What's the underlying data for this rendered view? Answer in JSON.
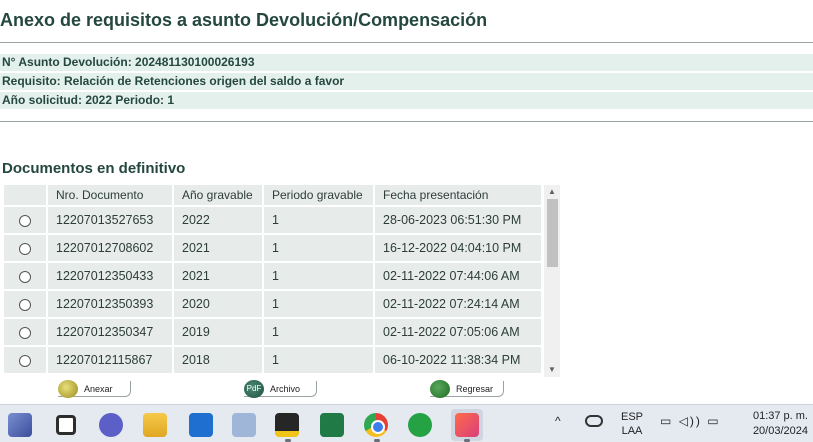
{
  "page": {
    "title": "Anexo de requisitos a asunto Devolución/Compensación"
  },
  "info": {
    "asunto": "N° Asunto Devolución: 202481130100026193",
    "requisito": "Requisito: Relación de Retenciones origen del saldo a favor",
    "anio_solicitud": "Año solicitud: 2022 Periodo: 1"
  },
  "documents": {
    "section_title": "Documentos en definitivo",
    "columns": [
      "Nro. Documento",
      "Año gravable",
      "Periodo gravable",
      "Fecha presentación"
    ],
    "rows": [
      {
        "nro": "12207013527653",
        "anio": "2022",
        "periodo": "1",
        "fecha": "28-06-2023 06:51:30 PM"
      },
      {
        "nro": "12207012708602",
        "anio": "2021",
        "periodo": "1",
        "fecha": "16-12-2022 04:04:10 PM"
      },
      {
        "nro": "12207012350433",
        "anio": "2021",
        "periodo": "1",
        "fecha": "02-11-2022 07:44:06 AM"
      },
      {
        "nro": "12207012350393",
        "anio": "2020",
        "periodo": "1",
        "fecha": "02-11-2022 07:24:14 AM"
      },
      {
        "nro": "12207012350347",
        "anio": "2019",
        "periodo": "1",
        "fecha": "02-11-2022 07:05:06 AM"
      },
      {
        "nro": "12207012115867",
        "anio": "2018",
        "periodo": "1",
        "fecha": "06-10-2022 11:38:34 PM"
      }
    ]
  },
  "actions": {
    "anexar": "Anexar",
    "archivo": "Archivo",
    "archivo_icon_text": "PdF",
    "regresar": "Regresar"
  },
  "taskbar": {
    "lang_top": "ESP",
    "lang_bottom": "LAA",
    "time": "01:37 p. m.",
    "date": "20/03/2024",
    "chevron": "^"
  },
  "icons": [
    "widgets-icon",
    "task-view-icon",
    "teams-icon",
    "file-explorer-icon",
    "app-s-icon",
    "network-app-icon",
    "sticky-notes-icon",
    "excel-icon",
    "chrome-icon",
    "whatsapp-icon",
    "snipping-tool-icon",
    "onedrive-cloud-icon"
  ],
  "colors": {
    "heading": "#24473f",
    "info_band": "#e4f0ec",
    "table_cell": "#e7ecea"
  }
}
